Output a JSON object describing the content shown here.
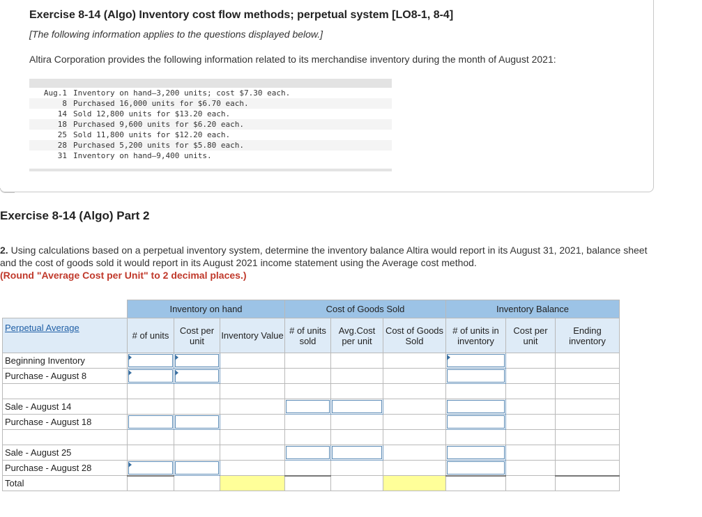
{
  "exercise": {
    "title": "Exercise 8-14 (Algo) Inventory cost flow methods; perpetual system [LO8-1, 8-4]",
    "note": "[The following information applies to the questions displayed below.]",
    "intro": "Altira Corporation provides the following information related to its merchandise inventory during the month of August 2021:",
    "lines": [
      {
        "day": "Aug.1",
        "text": "Inventory on hand—3,200 units; cost $7.30 each."
      },
      {
        "day": "8",
        "text": "Purchased 16,000 units for $6.70 each."
      },
      {
        "day": "14",
        "text": "Sold 12,800 units for $13.20 each."
      },
      {
        "day": "18",
        "text": "Purchased 9,600 units for $6.20 each."
      },
      {
        "day": "25",
        "text": "Sold 11,800 units for $12.20 each."
      },
      {
        "day": "28",
        "text": "Purchased 5,200 units for $5.80 each."
      },
      {
        "day": "31",
        "text": "Inventory on hand—9,400 units."
      }
    ]
  },
  "part": {
    "title": "Exercise 8-14 (Algo) Part 2",
    "q_num": "2.",
    "question": " Using calculations based on a perpetual inventory system, determine the inventory balance Altira would report in its August 31, 2021, balance sheet and the cost of goods sold it would report in its August 2021 income statement using the Average cost method.",
    "instruction": "(Round \"Average Cost per Unit\" to 2 decimal places.)"
  },
  "table": {
    "groups": {
      "on_hand": "Inventory on hand",
      "cogs": "Cost of Goods Sold",
      "balance": "Inventory Balance"
    },
    "row_header": "Perpetual Average",
    "cols": {
      "units": "# of units",
      "cost_unit": "Cost per unit",
      "inv_value": "Inventory Value",
      "units_sold": "# of units sold",
      "avg_cost": "Avg.Cost per unit",
      "cogs": "Cost of Goods Sold",
      "units_inv": "# of units in inventory",
      "bal_cost_unit": "Cost per unit",
      "ending_inv": "Ending inventory"
    },
    "rows": {
      "beginning": "Beginning Inventory",
      "purchase_aug8": "Purchase - August 8",
      "sale_aug14": "Sale - August 14",
      "purchase_aug18": "Purchase - August 18",
      "sale_aug25": "Sale - August 25",
      "purchase_aug28": "Purchase - August 28",
      "total": "Total"
    }
  },
  "colors": {
    "header_blue": "#9cc3e6",
    "header_light": "#deebf7",
    "total_yellow": "#ffff99",
    "instruction_red": "#c0392b"
  }
}
